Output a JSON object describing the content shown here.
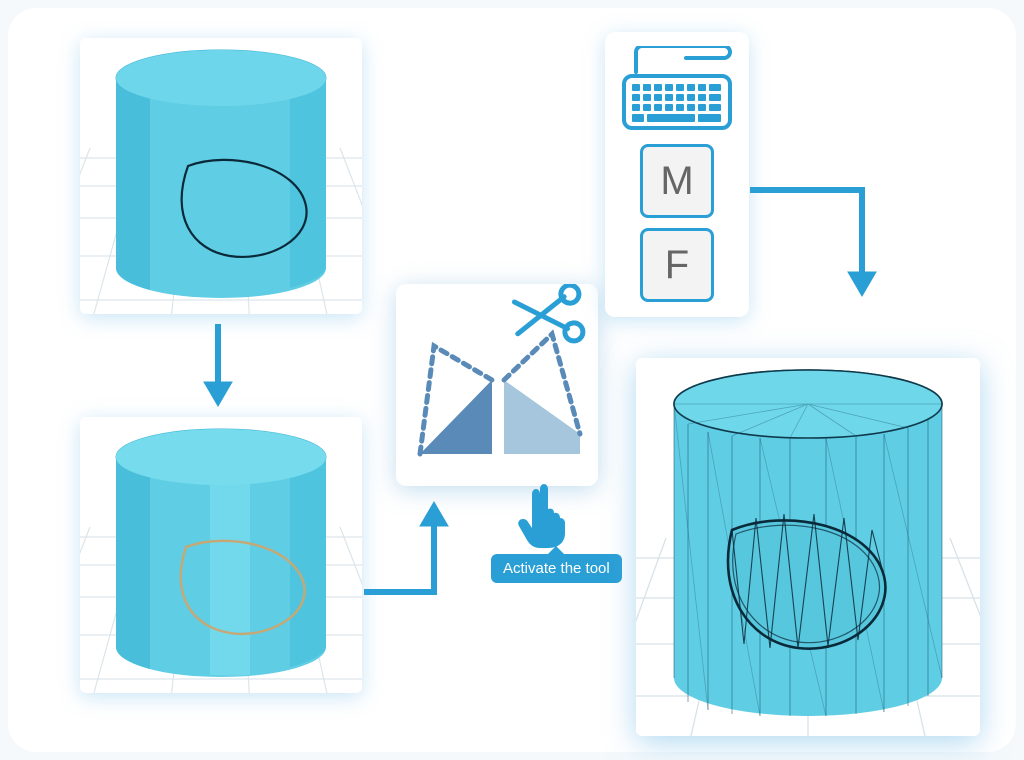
{
  "colors": {
    "accent": "#2a9fd6",
    "cylinder_fill": "#5fcde4",
    "cylinder_shade": "#3bb4d6",
    "tool_fill_light": "#a6c6de",
    "tool_fill_dark": "#5a8bb8",
    "grid": "#dde6ec"
  },
  "tooltip": {
    "label": "Activate the tool"
  },
  "keys": {
    "key1": "M",
    "key2": "F"
  },
  "steps": {
    "step1": {
      "name": "cylinder-with-drawn-loop"
    },
    "step2": {
      "name": "cylinder-with-highlighted-loop"
    },
    "tool": {
      "name": "cut-and-sew-tool"
    },
    "shortcut": {
      "name": "keyboard-shortcut-MF"
    },
    "result": {
      "name": "cylinder-with-cut-hole-wireframe"
    }
  }
}
